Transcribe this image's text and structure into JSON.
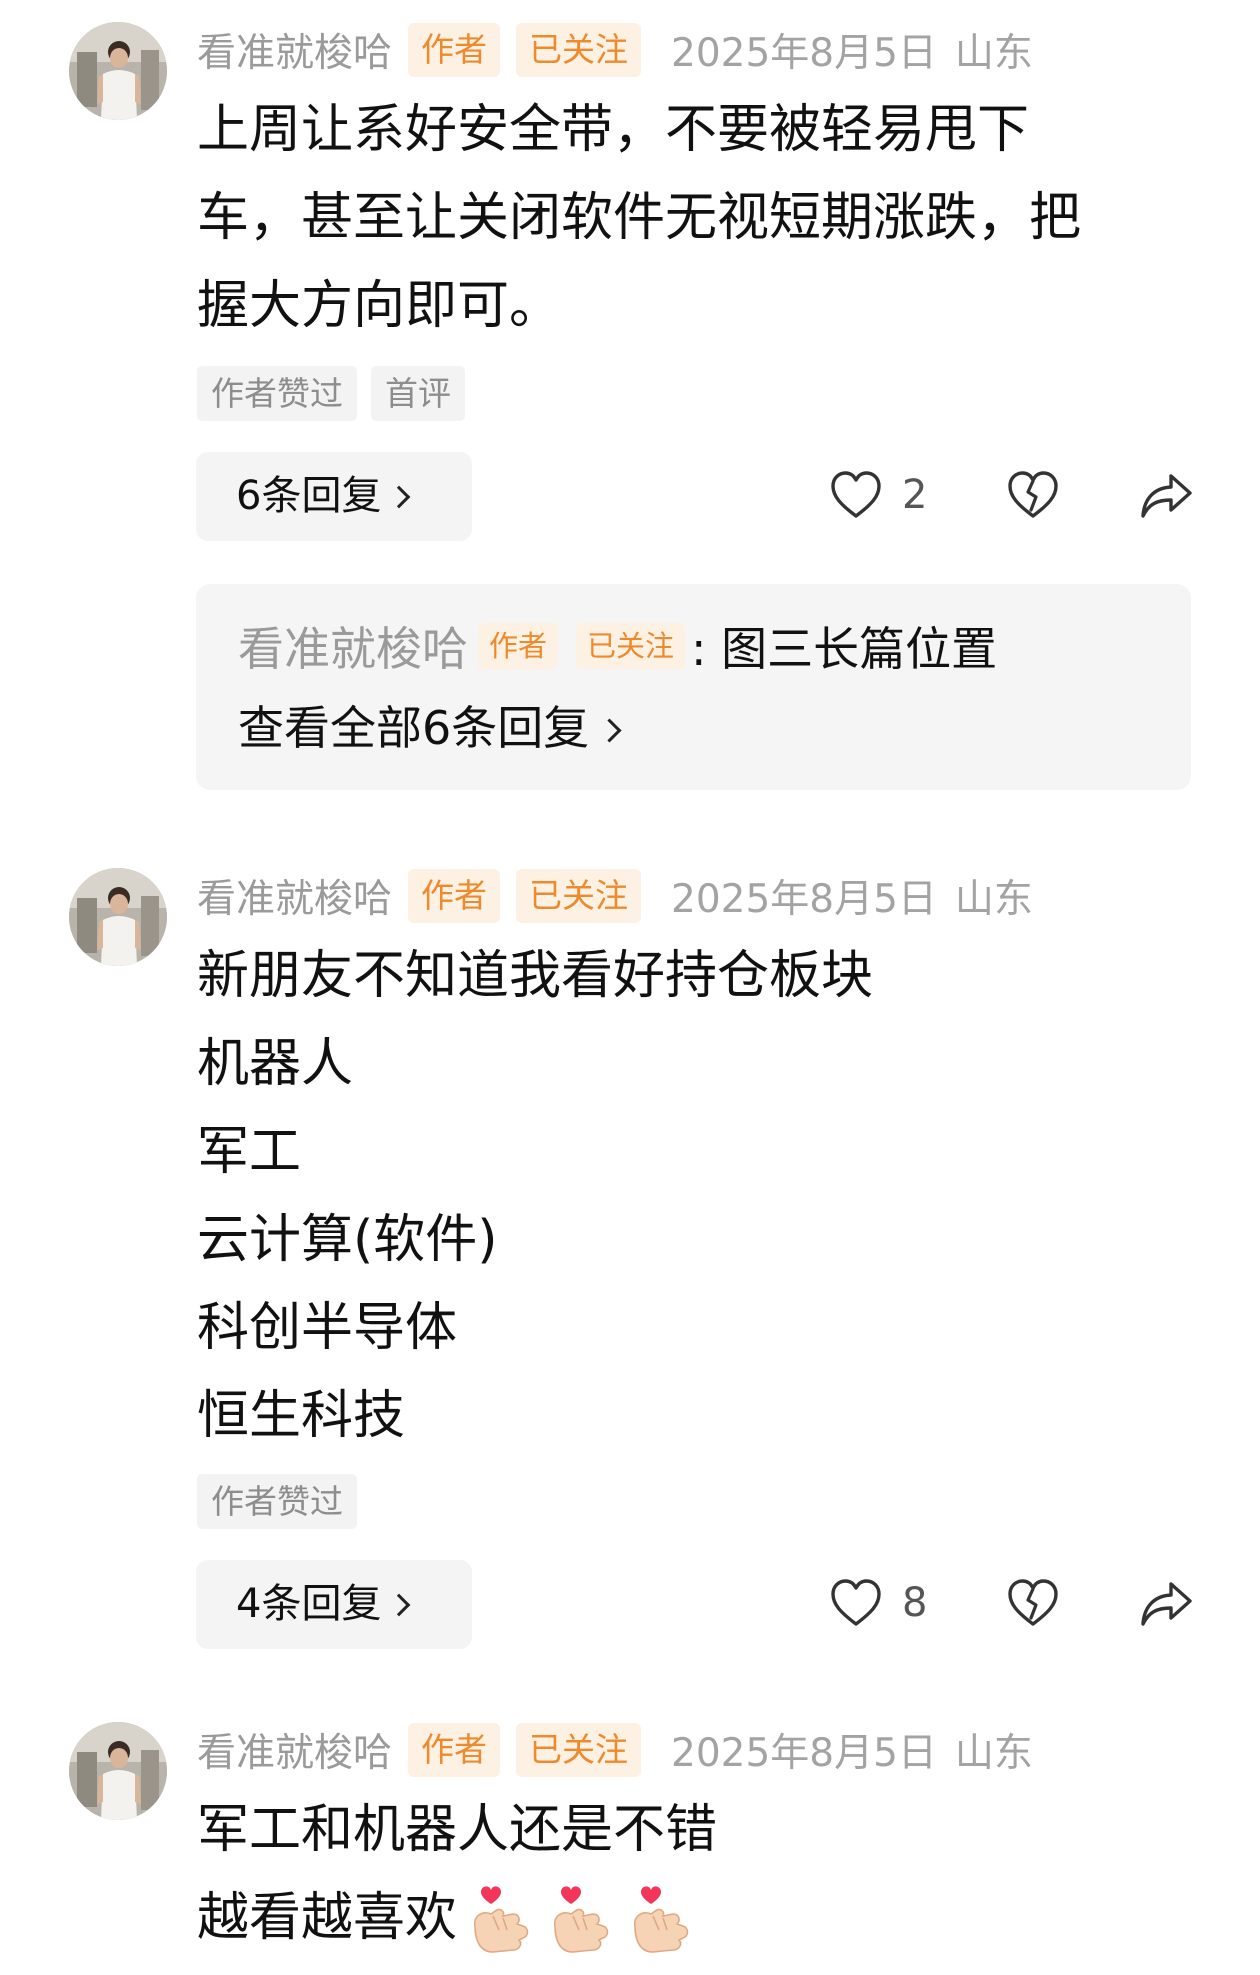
{
  "comments": [
    {
      "author": "看准就梭哈",
      "tags": [
        "作者",
        "已关注"
      ],
      "date": "2025年8月5日",
      "location": "山东",
      "lines": [
        "上周让系好安全带，不要被轻易甩下",
        "车，甚至让关闭软件无视短期涨跌，把",
        "握大方向即可。"
      ],
      "labels": [
        "作者赞过",
        "首评"
      ],
      "replies_label": "6条回复",
      "like_count": "2",
      "reply_preview": {
        "author": "看准就梭哈",
        "tags": [
          "作者",
          "已关注"
        ],
        "text": ": 图三长篇位置",
        "view_all": "查看全部6条回复"
      }
    },
    {
      "author": "看准就梭哈",
      "tags": [
        "作者",
        "已关注"
      ],
      "date": "2025年8月5日",
      "location": "山东",
      "lines": [
        "新朋友不知道我看好持仓板块",
        "机器人",
        "军工",
        "云计算(软件)",
        "科创半导体",
        "恒生科技"
      ],
      "labels": [
        "作者赞过"
      ],
      "replies_label": "4条回复",
      "like_count": "8"
    },
    {
      "author": "看准就梭哈",
      "tags": [
        "作者",
        "已关注"
      ],
      "date": "2025年8月5日",
      "location": "山东",
      "lines": [
        "军工和机器人还是不错",
        "越看越喜欢"
      ],
      "emojis": [
        "finger-heart-emoji",
        "finger-heart-emoji",
        "finger-heart-emoji"
      ]
    }
  ],
  "colors": {
    "tag_text": "#ee8a2c",
    "tag_bg": "#fdf1e3",
    "meta_text": "#a3a3a3"
  },
  "icons": {
    "like": "heart-outline-icon",
    "dislike": "broken-heart-icon",
    "share": "share-arrow-icon"
  }
}
